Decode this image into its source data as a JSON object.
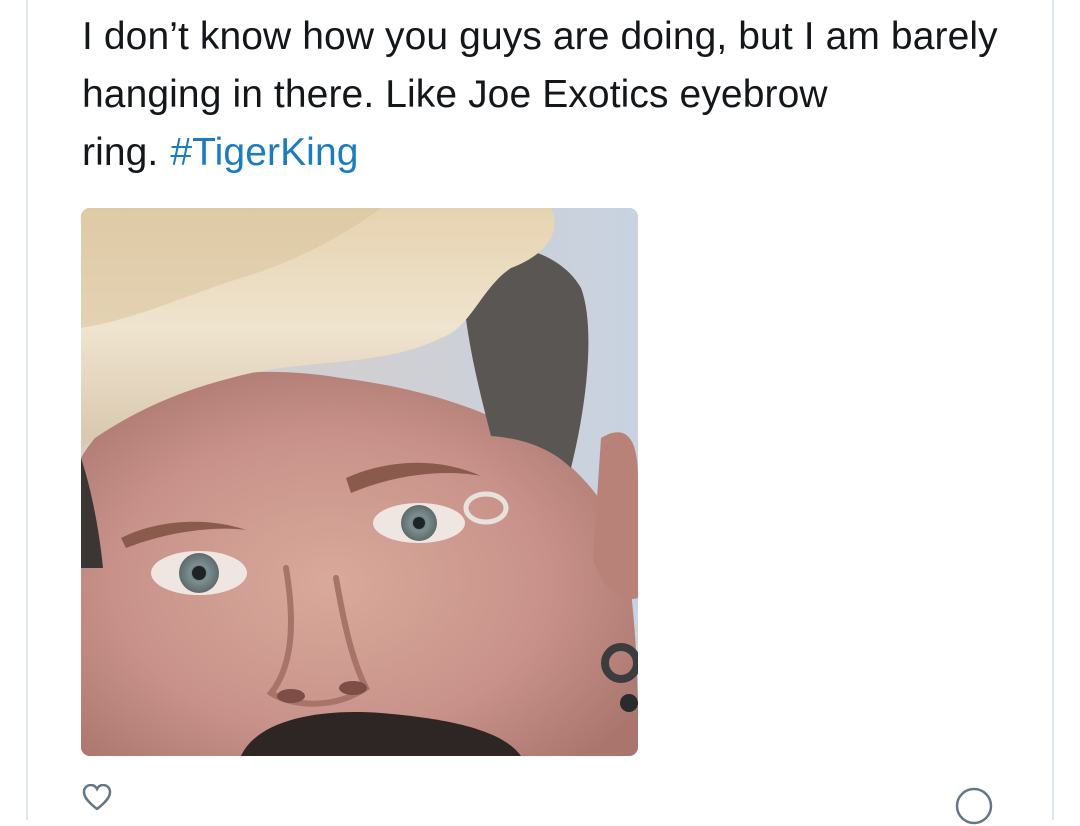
{
  "tweet": {
    "text": "I don’t know how you guys are doing, but I am barely hanging in there. Like Joe Exotics eyebrow ring.",
    "hashtag": "#TigerKing"
  },
  "media": {
    "icon": "photo",
    "subject": "close-up portrait photo"
  },
  "footer": {
    "like_icon": "heart-icon",
    "info_icon": "info-icon",
    "colors": {
      "hashtag": "#1b7cc0",
      "muted": "#657786",
      "border": "#e1e8ed",
      "text": "#14171a"
    }
  }
}
